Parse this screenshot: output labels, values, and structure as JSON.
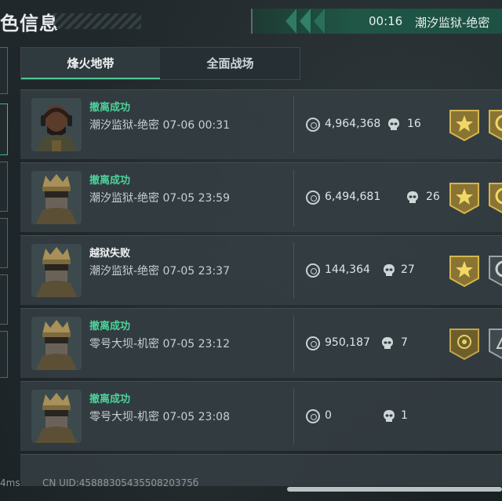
{
  "header": {
    "title": "色信息",
    "time": "00:16",
    "map": "潮汐监狱-绝密"
  },
  "tabs": [
    {
      "label": "烽火地带",
      "active": true
    },
    {
      "label": "全面战场",
      "active": false
    }
  ],
  "matches": [
    {
      "status": "撤离成功",
      "result": "success",
      "map": "潮汐监狱-绝密",
      "datetime": "07-06 00:31",
      "value": "4,964,368",
      "kills": "16"
    },
    {
      "status": "撤离成功",
      "result": "success",
      "map": "潮汐监狱-绝密",
      "datetime": "07-05 23:59",
      "value": "6,494,681",
      "kills": "26"
    },
    {
      "status": "越狱失败",
      "result": "fail",
      "map": "潮汐监狱-绝密",
      "datetime": "07-05 23:37",
      "value": "144,364",
      "kills": "27"
    },
    {
      "status": "撤离成功",
      "result": "success",
      "map": "零号大坝-机密",
      "datetime": "07-05 23:12",
      "value": "950,187",
      "kills": "7"
    },
    {
      "status": "撤离成功",
      "result": "success",
      "map": "零号大坝-机密",
      "datetime": "07-05 23:08",
      "value": "0",
      "kills": "1"
    }
  ],
  "footer": {
    "ping": "4ms",
    "uid": "CN UID:4588830543550820375б"
  },
  "colors": {
    "success": "#4ed29a",
    "accent": "#1f5646",
    "badge_gold": "#c9a441"
  }
}
